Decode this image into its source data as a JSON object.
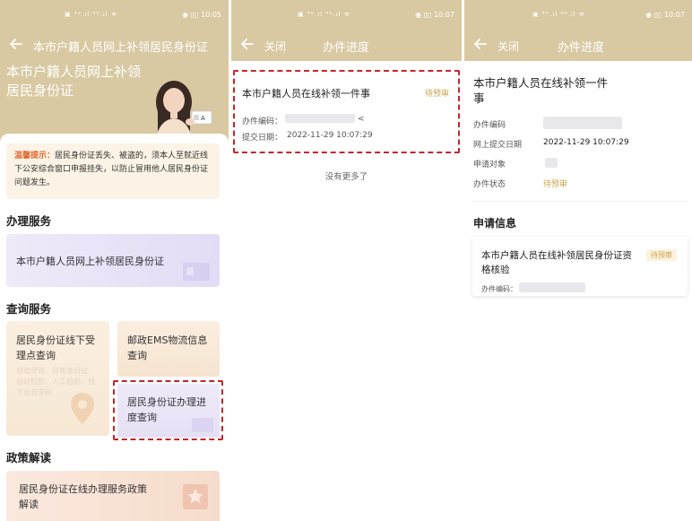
{
  "status": {
    "p1_time": "10:05",
    "p2_time": "10:07",
    "p3_time": "10:07"
  },
  "colors": {
    "header": "#d9c9a3",
    "accent_orange": "#e0662a",
    "pending": "#c9a54e",
    "dash": "#c4262b"
  },
  "p1": {
    "nav_title": "本市户籍人员网上补领居民身份证",
    "hero_title": "本市户籍人员网上补领居民身份证",
    "hero_badge": "A",
    "tip_label": "温馨提示：",
    "tip_text": "居民身份证丢失、被盗的，须本人至就近线下公安综合窗口申报挂失，以防止冒用他人居民身份证问题发生。",
    "sec_handle": "办理服务",
    "card_handle": "本市户籍人员网上补领居民身份证",
    "sec_query": "查询服务",
    "tile_offline": "居民身份证线下受理点查询",
    "tile_offline_sub": "自助受理、邮寄身份证、自助拍照、人工拍照、线下业务查询",
    "tile_ems": "邮政EMS物流信息查询",
    "tile_progress": "居民身份证办理进度查询",
    "sec_policy": "政策解读",
    "card_policy": "居民身份证在线办理服务政策解读"
  },
  "p2": {
    "close": "关闭",
    "nav_title": "办件进度",
    "item_title": "本市户籍人员在线补领一件事",
    "item_status": "待预审",
    "code_label": "办件编码：",
    "code_tail": "<",
    "date_label": "提交日期：",
    "date_value": "2022-11-29 10:07:29",
    "no_more": "没有更多了"
  },
  "p3": {
    "close": "关闭",
    "nav_title": "办件进度",
    "title": "本市户籍人员在线补领一件事",
    "k_code": "办件编码",
    "k_submit": "网上提交日期",
    "v_submit": "2022-11-29 10:07:29",
    "k_applicant": "申请对象",
    "k_status": "办件状态",
    "v_status": "待预审",
    "sec_apply": "申请信息",
    "card_title": "本市户籍人员在线补领居民身份证资格核验",
    "card_status": "待预审",
    "card_code_label": "办件编码："
  }
}
